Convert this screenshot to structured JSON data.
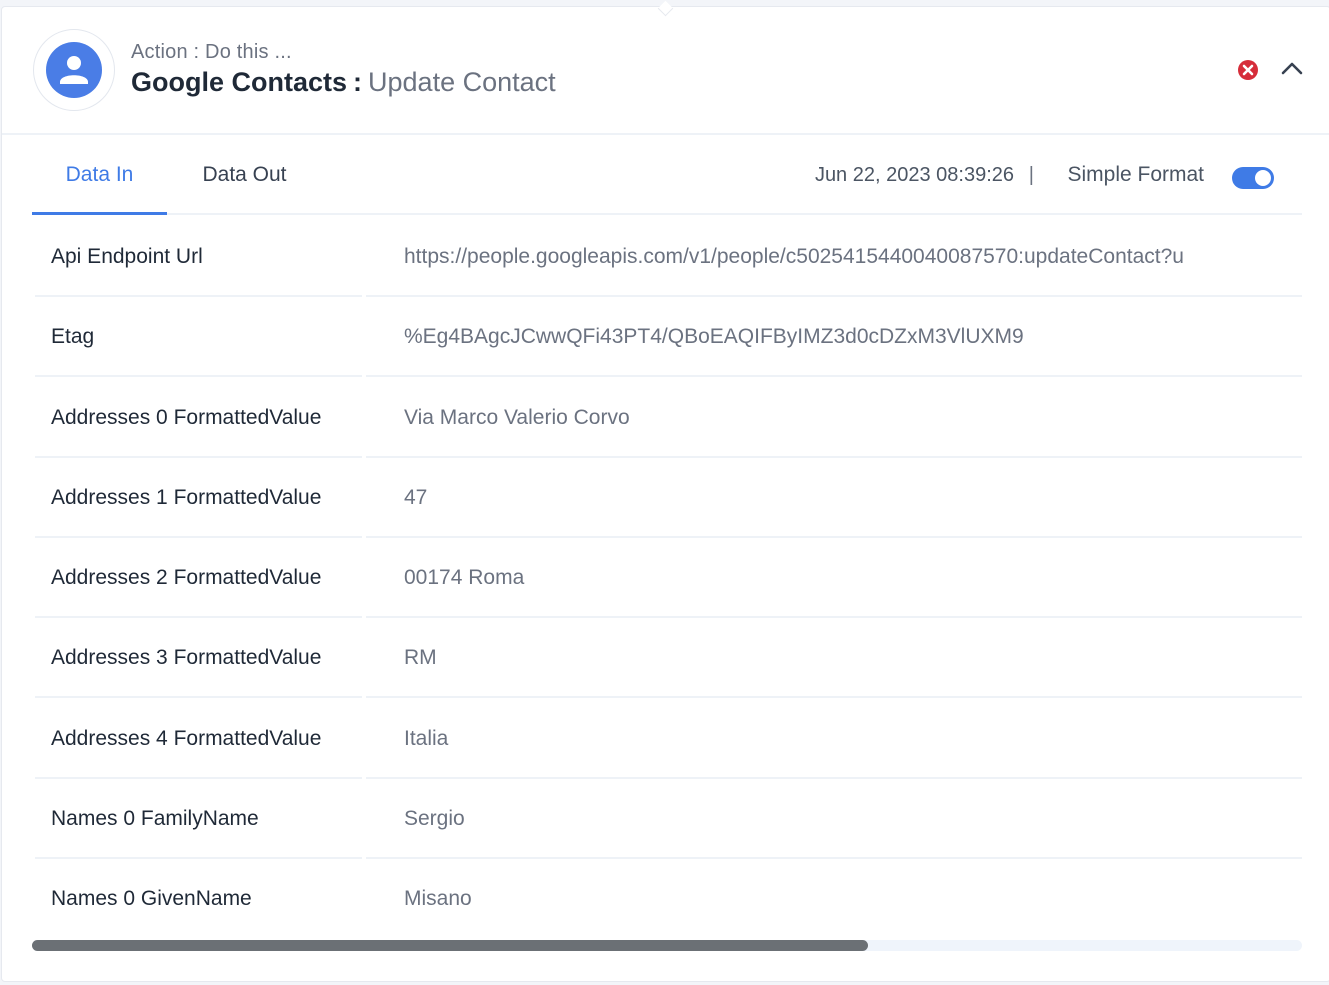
{
  "header": {
    "subtitle": "Action : Do this ...",
    "app_name": "Google Contacts",
    "separator": ":",
    "action_name": "Update Contact",
    "icon": "person-icon",
    "icon_color": "#4a7de6"
  },
  "controls": {
    "close_icon": "close-circle-icon",
    "close_color": "#d62d3a",
    "collapse_icon": "chevron-up-icon"
  },
  "tabs": [
    {
      "label": "Data In",
      "active": true
    },
    {
      "label": "Data Out",
      "active": false
    }
  ],
  "meta": {
    "timestamp": "Jun 22, 2023 08:39:26",
    "divider": "|",
    "format_label": "Simple Format",
    "format_enabled": true
  },
  "fields": [
    {
      "key": "Api Endpoint Url",
      "value": "https://people.googleapis.com/v1/people/c5025415440040087570:updateContact?u"
    },
    {
      "key": "Etag",
      "value": "%Eg4BAgcJCwwQFi43PT4/QBoEAQIFByIMZ3d0cDZxM3VlUXM9"
    },
    {
      "key": "Addresses 0 FormattedValue",
      "value": "Via Marco Valerio Corvo"
    },
    {
      "key": "Addresses 1 FormattedValue",
      "value": "47"
    },
    {
      "key": "Addresses 2 FormattedValue",
      "value": "00174 Roma"
    },
    {
      "key": "Addresses 3 FormattedValue",
      "value": "RM"
    },
    {
      "key": "Addresses 4 FormattedValue",
      "value": "Italia"
    },
    {
      "key": "Names 0 FamilyName",
      "value": "Sergio"
    },
    {
      "key": "Names 0 GivenName",
      "value": "Misano"
    }
  ],
  "scrollbar": {
    "position_fraction": 0.0,
    "visible_fraction": 0.658
  },
  "accent_color": "#3f7be6"
}
